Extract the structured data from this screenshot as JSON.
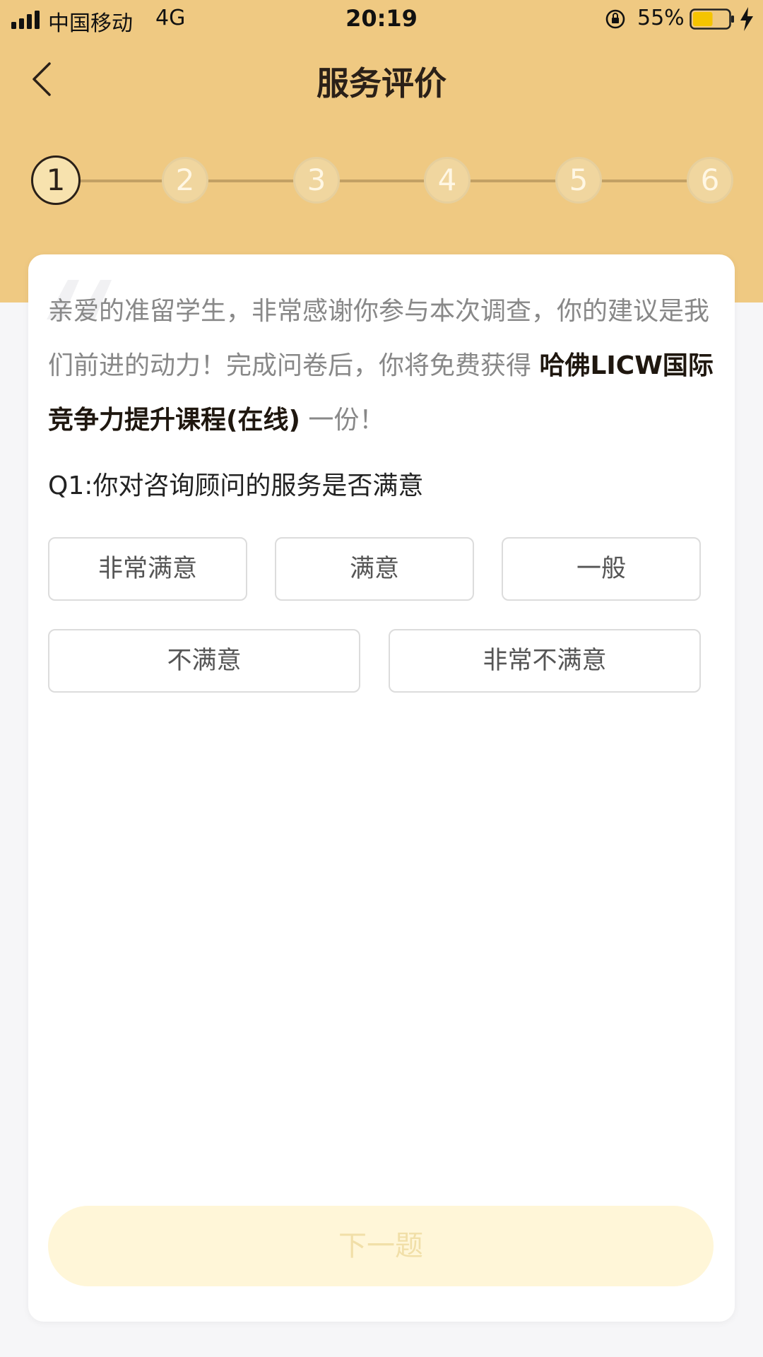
{
  "status_bar": {
    "carrier": "中国移动",
    "network": "4G",
    "time": "20:19",
    "battery_percent": "55%",
    "battery_level": 0.55,
    "icons": [
      "signal-icon",
      "rotation-lock-icon",
      "battery-icon",
      "charging-icon"
    ]
  },
  "nav": {
    "title": "服务评价",
    "back_icon": "chevron-left-icon"
  },
  "steps": [
    {
      "label": "1",
      "active": true
    },
    {
      "label": "2",
      "active": false
    },
    {
      "label": "3",
      "active": false
    },
    {
      "label": "4",
      "active": false
    },
    {
      "label": "5",
      "active": false
    },
    {
      "label": "6",
      "active": false
    }
  ],
  "intro": {
    "text_before": "亲爱的准留学生，非常感谢你参与本次调查，你的建议是我们前进的动力！完成问卷后，你将免费获得 ",
    "highlight": "哈佛LICW国际竞争力提升课程(在线)",
    "text_after": " 一份！"
  },
  "question": {
    "label": "Q1:你对咨询顾问的服务是否满意",
    "options": [
      "非常满意",
      "满意",
      "一般",
      "不满意",
      "非常不满意"
    ]
  },
  "footer": {
    "next_label": "下一题"
  },
  "colors": {
    "header": "#efc982",
    "background": "#f6f6f8",
    "next_button_bg": "#fff6d8",
    "next_button_text": "#f1dfa8"
  }
}
